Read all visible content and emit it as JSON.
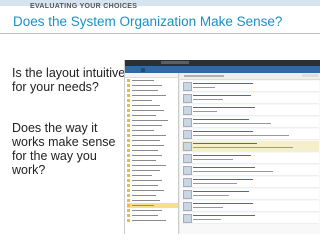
{
  "slide": {
    "eyebrow": "EVALUATING YOUR CHOICES",
    "title": "Does the System Organization Make Sense?",
    "question_1": "Is the layout intuitive for your needs?",
    "question_2": "Does the way it works make sense for the way you work?"
  },
  "colors": {
    "title": "#1a8fc9",
    "app_nav": "#2e6aa8",
    "app_bar": "#2d2f33",
    "selected_folder": "#f6e08a"
  }
}
